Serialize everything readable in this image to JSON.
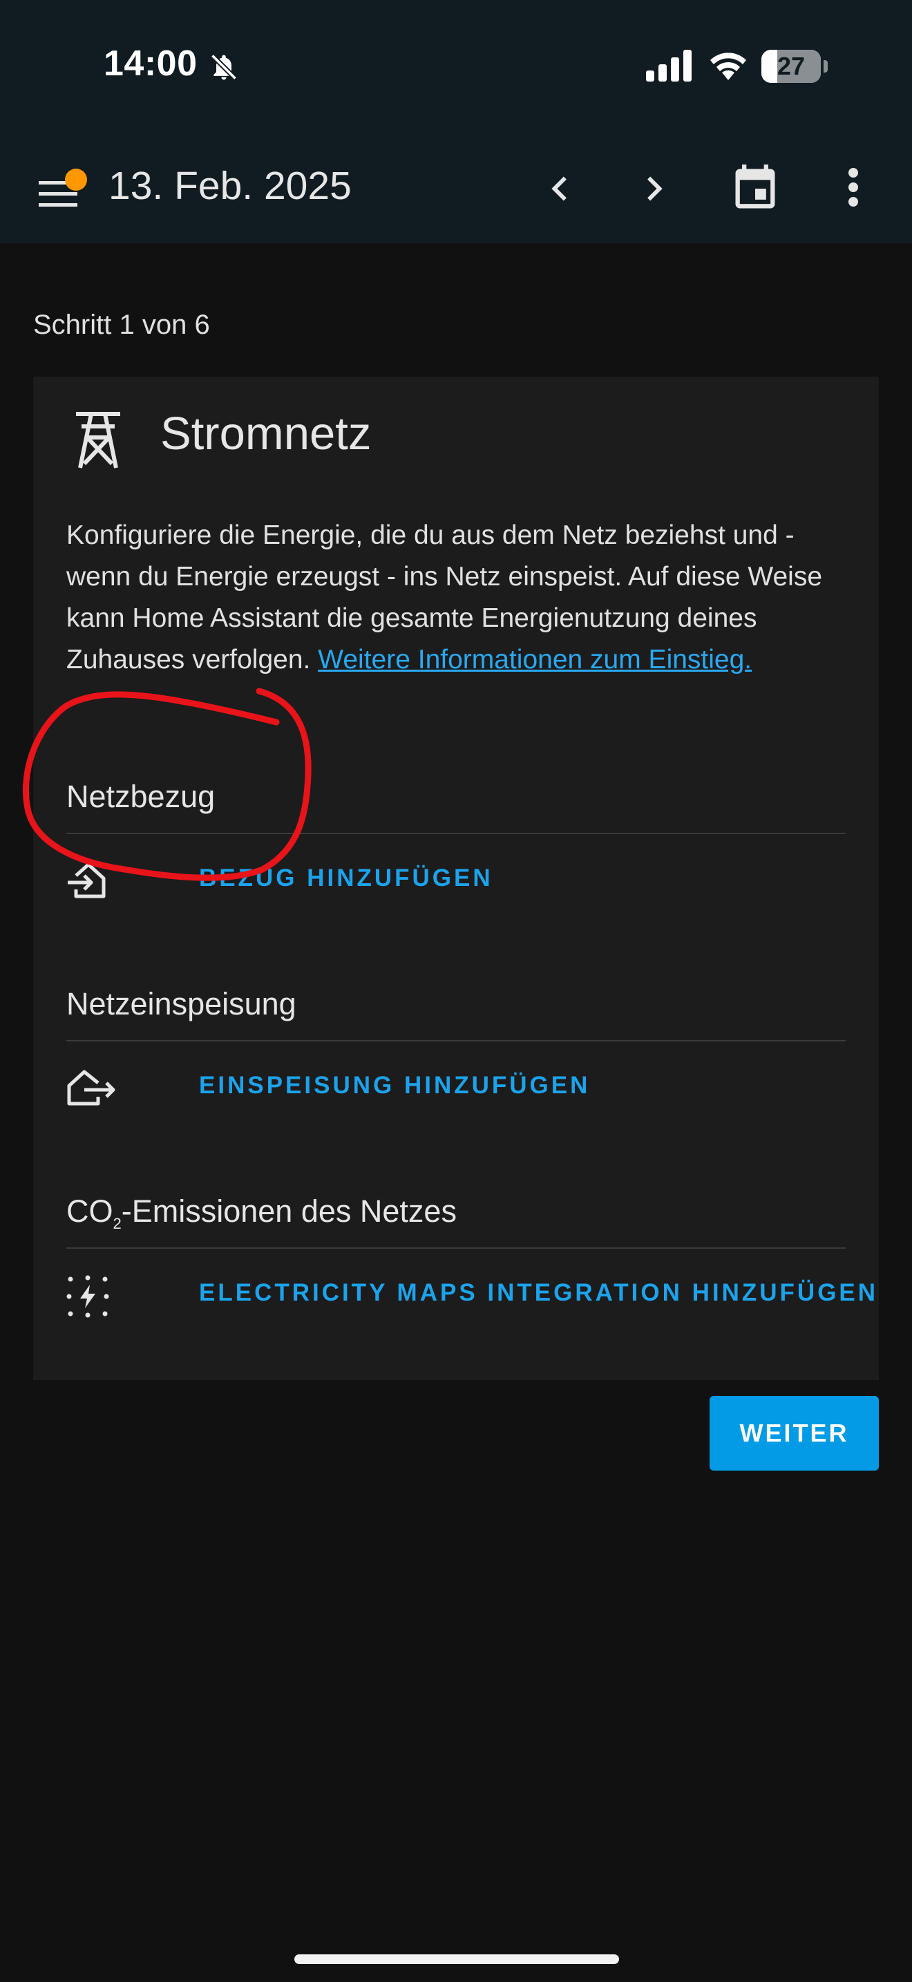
{
  "status_bar": {
    "time": "14:00",
    "battery_level": "27",
    "battery_fraction": 0.27,
    "icons": [
      "bell-off-icon",
      "signal-icon",
      "wifi-icon",
      "battery-icon"
    ]
  },
  "app_bar": {
    "title": "13. Feb. 2025",
    "icons": [
      "menu-icon",
      "chevron-left-icon",
      "chevron-right-icon",
      "calendar-icon",
      "more-vert-icon"
    ],
    "badge_color": "#ff9800",
    "background": "#101b22"
  },
  "step": {
    "label": "Schritt 1 von 6"
  },
  "card": {
    "icon": "transmission-tower-icon",
    "title": "Stromnetz",
    "description": "Konfiguriere die Energie, die du aus dem Netz beziehst und - wenn du Energie erzeugst - ins Netz einspeist. Auf diese Weise kann Home Assistant die gesamte Energienutzung deines Zuhauses verfolgen.",
    "link_text": "Weitere Informationen zum Einstieg.",
    "sections": [
      {
        "title": "Netzbezug",
        "action_icon": "transmission-tower-import-icon",
        "action_label": "BEZUG HINZUFÜGEN"
      },
      {
        "title": "Netzeinspeisung",
        "action_icon": "transmission-tower-export-icon",
        "action_label": "EINSPEISUNG HINZUFÜGEN"
      },
      {
        "title_prefix": "CO",
        "title_sub": "2",
        "title_suffix": "-Emissionen des Netzes",
        "action_icon": "lightning-dots-icon",
        "action_label": "ELECTRICITY MAPS INTEGRATION HINZUFÜGEN"
      }
    ]
  },
  "next_button": {
    "label": "WEITER"
  },
  "colors": {
    "accent": "#039be5",
    "link": "#29a8f0",
    "annotation": "#e8141a"
  }
}
